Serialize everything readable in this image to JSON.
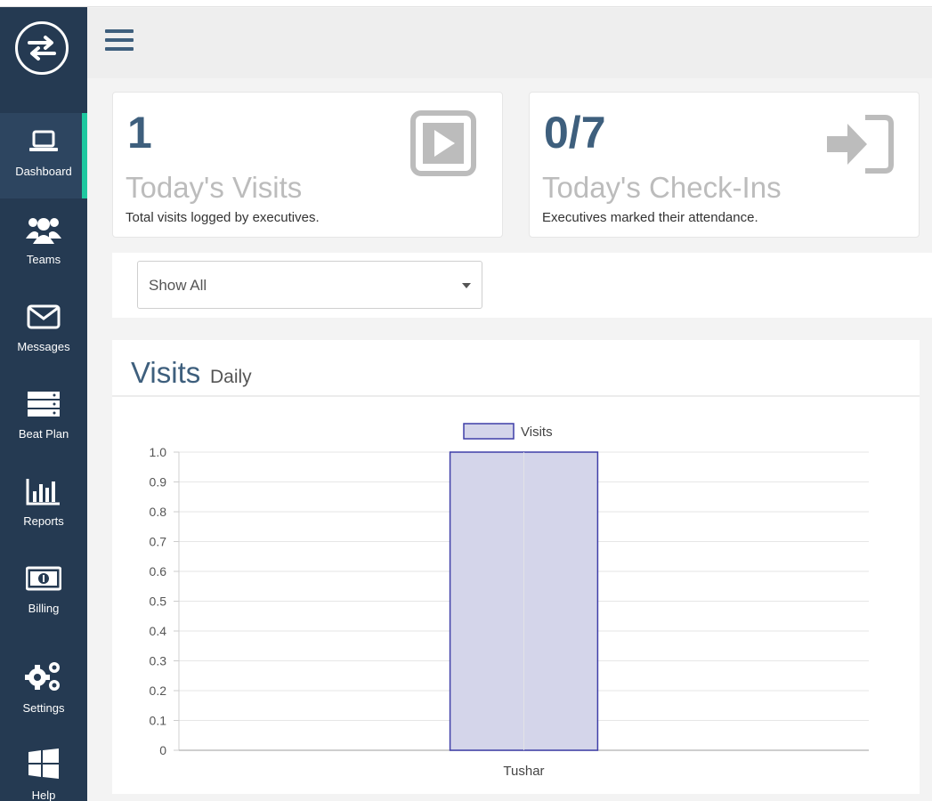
{
  "sidebar": {
    "items": [
      {
        "label": "Dashboard",
        "icon": "laptop-icon",
        "active": true
      },
      {
        "label": "Teams",
        "icon": "users-icon"
      },
      {
        "label": "Messages",
        "icon": "envelope-icon"
      },
      {
        "label": "Beat Plan",
        "icon": "server-icon"
      },
      {
        "label": "Reports",
        "icon": "bar-chart-icon"
      },
      {
        "label": "Billing",
        "icon": "money-icon"
      },
      {
        "label": "Settings",
        "icon": "gears-icon"
      },
      {
        "label": "Help",
        "icon": "windows-icon"
      }
    ]
  },
  "cards": [
    {
      "value": "1",
      "title": "Today's Visits",
      "subtitle": "Total visits logged by executives.",
      "icon": "play-square-icon"
    },
    {
      "value": "0/7",
      "title": "Today's Check-Ins",
      "subtitle": "Executives marked their attendance.",
      "icon": "sign-in-icon"
    }
  ],
  "filter": {
    "selected": "Show All"
  },
  "panel": {
    "title": "Visits",
    "subtitle": "Daily"
  },
  "colors": {
    "sidebar": "#253a52",
    "accent": "#1ec8a0",
    "primary": "#3e5f7d",
    "bar_fill": "#d4d5ea",
    "bar_border": "#3f3fa8"
  },
  "chart_data": {
    "type": "bar",
    "categories": [
      "Tushar"
    ],
    "series": [
      {
        "name": "Visits",
        "values": [
          1
        ]
      }
    ],
    "ylim": [
      0,
      1.0
    ],
    "yticks": [
      "1.0",
      "0.9",
      "0.8",
      "0.7",
      "0.6",
      "0.5",
      "0.4",
      "0.3",
      "0.2",
      "0.1",
      "0"
    ],
    "legend": "top-center",
    "grid": true
  }
}
